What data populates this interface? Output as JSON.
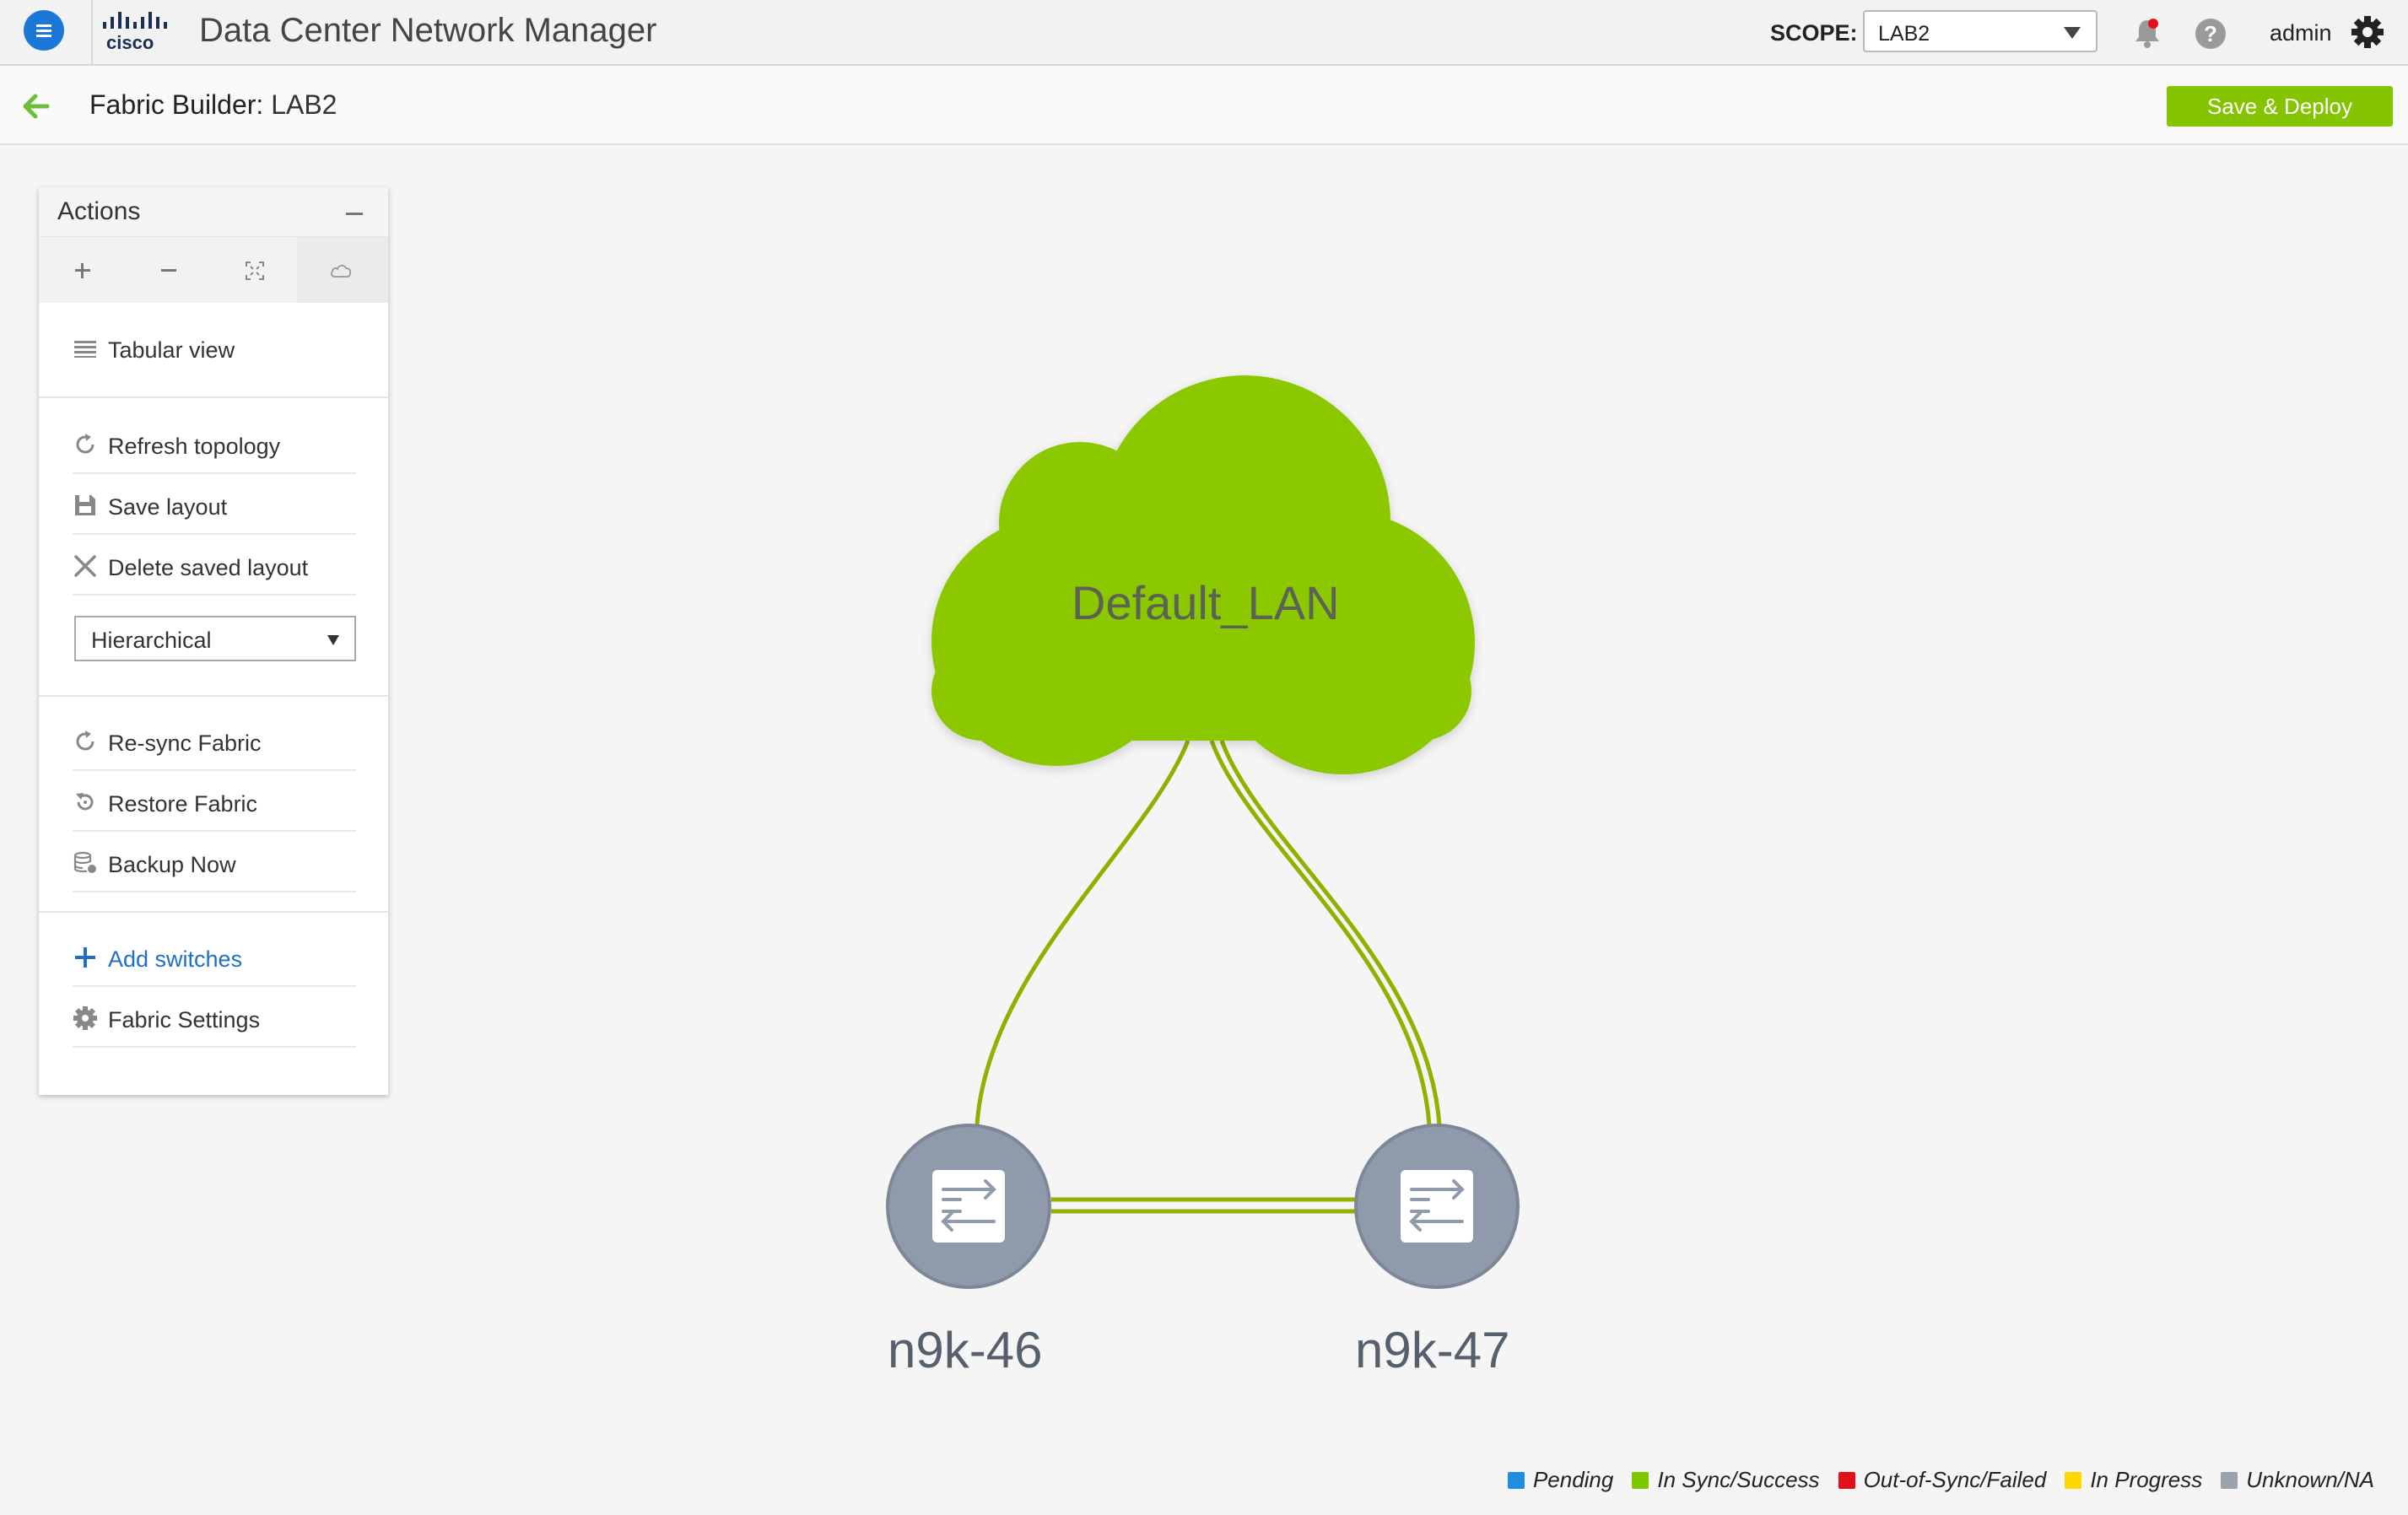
{
  "header": {
    "app_title": "Data Center Network Manager",
    "scope_label": "SCOPE:",
    "scope_value": "LAB2",
    "user": "admin",
    "icons": [
      "menu-icon",
      "cisco-logo",
      "bell-icon",
      "help-icon",
      "gear-icon"
    ],
    "help_glyph": "?"
  },
  "subbar": {
    "title_prefix": "Fabric Builder:",
    "title_value": "LAB2",
    "deploy_label": "Save & Deploy"
  },
  "actions": {
    "title": "Actions",
    "zoom_icons": [
      "zoom-in-icon",
      "zoom-out-icon",
      "fit-screen-icon",
      "cloud-icon"
    ],
    "tabular_view": "Tabular view",
    "refresh_topology": "Refresh topology",
    "save_layout": "Save layout",
    "delete_saved_layout": "Delete saved layout",
    "layout_value": "Hierarchical",
    "resync_fabric": "Re-sync Fabric",
    "restore_fabric": "Restore Fabric",
    "backup_now": "Backup Now",
    "add_switches": "Add switches",
    "fabric_settings": "Fabric Settings"
  },
  "topology": {
    "cloud": {
      "label": "Default_LAN",
      "color": "#8cc800"
    },
    "switches": [
      {
        "label": "n9k-46",
        "status_color": "#8f9bab"
      },
      {
        "label": "n9k-47",
        "status_color": "#8f9bab"
      }
    ],
    "link_color": "#8fb100"
  },
  "legend": [
    {
      "label": "Pending",
      "color": "#1f8ede"
    },
    {
      "label": "In Sync/Success",
      "color": "#7ec800"
    },
    {
      "label": "Out-of-Sync/Failed",
      "color": "#e3101b"
    },
    {
      "label": "In Progress",
      "color": "#ffd700"
    },
    {
      "label": "Unknown/NA",
      "color": "#9aa2ae"
    }
  ],
  "colors": {
    "accent": "#84c400",
    "link": "#1e6fc5",
    "menu": "#1c78d6"
  }
}
